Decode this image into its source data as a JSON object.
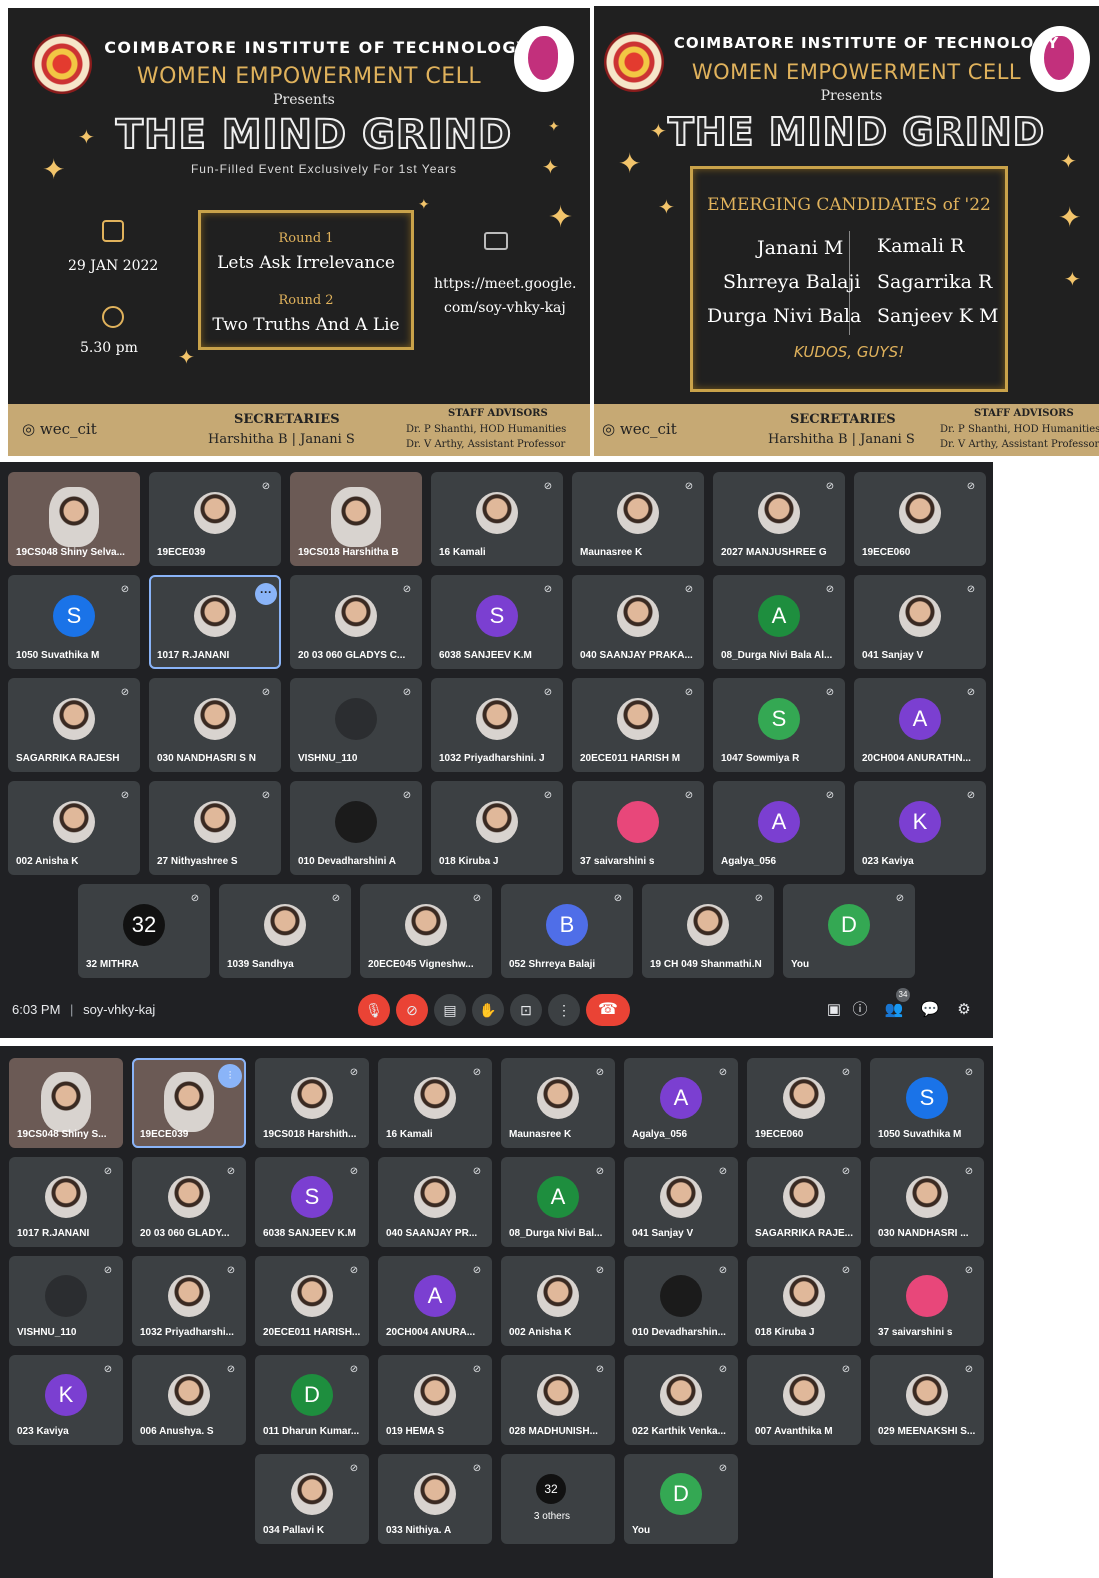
{
  "poster1": {
    "org": "COIMBATORE INSTITUTE OF TECHNOLOGY",
    "cell": "WOMEN EMPOWERMENT CELL",
    "presents": "Presents",
    "title": "THE MIND GRIND",
    "tagline": "Fun-Filled Event Exclusively For 1st Years",
    "date": "29 JAN 2022",
    "time": "5.30 pm",
    "round1_label": "Round 1",
    "round1_name": "Lets Ask Irrelevance",
    "round2_label": "Round 2",
    "round2_name": "Two Truths And A Lie",
    "link_line1": "https://meet.google.",
    "link_line2": "com/soy-vhky-kaj",
    "instagram": "wec_cit",
    "secretaries_heading": "SECRETARIES",
    "secretaries": "Harshitha B | Janani S",
    "advisors_heading": "STAFF ADVISORS",
    "advisor1": "Dr. P Shanthi, HOD Humanities",
    "advisor2": "Dr. V Arthy, Assistant Professor"
  },
  "poster2": {
    "org": "COIMBATORE INSTITUTE OF TECHNOLOGY",
    "cell": "WOMEN EMPOWERMENT CELL",
    "presents": "Presents",
    "title": "THE MIND GRIND",
    "heading": "EMERGING CANDIDATES of '22",
    "winners_left": [
      "Janani M",
      "Shrreya Balaji",
      "Durga Nivi Bala"
    ],
    "winners_right": [
      "Kamali R",
      "Sagarrika R",
      "Sanjeev K M"
    ],
    "kudos": "KUDOS, GUYS!",
    "instagram": "wec_cit",
    "secretaries_heading": "SECRETARIES",
    "secretaries": "Harshitha B | Janani S",
    "advisors_heading": "STAFF ADVISORS",
    "advisor1": "Dr. P Shanthi, HOD Humanities",
    "advisor2": "Dr. V Arthy, Assistant Professor"
  },
  "meet1": {
    "rows": [
      [
        {
          "name": "19CS048 Shiny Selva...",
          "kind": "video"
        },
        {
          "name": "19ECE039",
          "kind": "photo"
        },
        {
          "name": "19CS018 Harshitha B",
          "kind": "video"
        },
        {
          "name": "16 Kamali",
          "kind": "photo"
        },
        {
          "name": "Maunasree K",
          "kind": "photo"
        },
        {
          "name": "2027 MANJUSHREE G",
          "kind": "photo"
        },
        {
          "name": "19ECE060",
          "kind": "photo"
        }
      ],
      [
        {
          "name": "1050 Suvathika M",
          "kind": "letter",
          "letter": "S",
          "color": "#1a73e8"
        },
        {
          "name": "1017 R.JANANI",
          "kind": "photo",
          "active": true
        },
        {
          "name": "20 03 060 GLADYS C...",
          "kind": "photo"
        },
        {
          "name": "6038 SANJEEV K.M",
          "kind": "letter",
          "letter": "S",
          "color": "#7b3fd1"
        },
        {
          "name": "040 SAANJAY PRAKA...",
          "kind": "photo"
        },
        {
          "name": "08_Durga Nivi Bala Al...",
          "kind": "letter",
          "letter": "A",
          "color": "#1e8e3e"
        },
        {
          "name": "041 Sanjay V",
          "kind": "photo"
        }
      ],
      [
        {
          "name": "SAGARRIKA RAJESH",
          "kind": "photo"
        },
        {
          "name": "030 NANDHASRI S N",
          "kind": "photo"
        },
        {
          "name": "VISHNU_110",
          "kind": "grey"
        },
        {
          "name": "1032 Priyadharshini. J",
          "kind": "photo"
        },
        {
          "name": "20ECE011 HARISH M",
          "kind": "photo"
        },
        {
          "name": "1047 Sowmiya R",
          "kind": "letter",
          "letter": "S",
          "color": "#34a853"
        },
        {
          "name": "20CH004 ANURATHN...",
          "kind": "letter",
          "letter": "A",
          "color": "#7b3fd1"
        }
      ],
      [
        {
          "name": "002 Anisha K",
          "kind": "photo"
        },
        {
          "name": "27 Nithyashree S",
          "kind": "photo"
        },
        {
          "name": "010 Devadharshini A",
          "kind": "dark"
        },
        {
          "name": "018 Kiruba J",
          "kind": "photo"
        },
        {
          "name": "37 saivarshini s",
          "kind": "letter",
          "letter": "",
          "color": "#e8477a"
        },
        {
          "name": "Agalya_056",
          "kind": "letter",
          "letter": "A",
          "color": "#7b3fd1"
        },
        {
          "name": "023 Kaviya",
          "kind": "letter",
          "letter": "K",
          "color": "#7b3fd1"
        }
      ],
      [
        {
          "name": "32 MITHRA",
          "kind": "letter",
          "letter": "32",
          "color": "#111111"
        },
        {
          "name": "1039 Sandhya",
          "kind": "photo"
        },
        {
          "name": "20ECE045 Vigneshw...",
          "kind": "photo"
        },
        {
          "name": "052 Shrreya Balaji",
          "kind": "letter",
          "letter": "B",
          "color": "#4f6ee8"
        },
        {
          "name": "19 CH 049 Shanmathi.N",
          "kind": "photo"
        },
        {
          "name": "You",
          "kind": "letter",
          "letter": "D",
          "color": "#34a853"
        }
      ]
    ],
    "time": "6:03 PM",
    "meeting_code": "soy-vhky-kaj",
    "people_count": "34"
  },
  "meet2": {
    "rows": [
      [
        {
          "name": "19CS048 Shiny S...",
          "kind": "video"
        },
        {
          "name": "19ECE039",
          "kind": "video",
          "active": true,
          "speaking": true
        },
        {
          "name": "19CS018 Harshith...",
          "kind": "photo"
        },
        {
          "name": "16 Kamali",
          "kind": "photo"
        },
        {
          "name": "Maunasree K",
          "kind": "photo"
        },
        {
          "name": "Agalya_056",
          "kind": "letter",
          "letter": "A",
          "color": "#7b3fd1"
        },
        {
          "name": "19ECE060",
          "kind": "photo"
        },
        {
          "name": "1050 Suvathika M",
          "kind": "letter",
          "letter": "S",
          "color": "#1a73e8"
        }
      ],
      [
        {
          "name": "1017 R.JANANI",
          "kind": "photo"
        },
        {
          "name": "20 03 060 GLADY...",
          "kind": "photo"
        },
        {
          "name": "6038 SANJEEV K.M",
          "kind": "letter",
          "letter": "S",
          "color": "#7b3fd1"
        },
        {
          "name": "040 SAANJAY PR...",
          "kind": "photo"
        },
        {
          "name": "08_Durga Nivi Bal...",
          "kind": "letter",
          "letter": "A",
          "color": "#1e8e3e"
        },
        {
          "name": "041 Sanjay V",
          "kind": "photo"
        },
        {
          "name": "SAGARRIKA RAJE...",
          "kind": "photo"
        },
        {
          "name": "030 NANDHASRI ...",
          "kind": "photo"
        }
      ],
      [
        {
          "name": "VISHNU_110",
          "kind": "grey"
        },
        {
          "name": "1032 Priyadharshi...",
          "kind": "photo"
        },
        {
          "name": "20ECE011 HARISH...",
          "kind": "photo"
        },
        {
          "name": "20CH004 ANURA...",
          "kind": "letter",
          "letter": "A",
          "color": "#7b3fd1"
        },
        {
          "name": "002 Anisha K",
          "kind": "photo"
        },
        {
          "name": "010 Devadharshin...",
          "kind": "dark"
        },
        {
          "name": "018 Kiruba J",
          "kind": "photo"
        },
        {
          "name": "37 saivarshini s",
          "kind": "letter",
          "letter": "",
          "color": "#e8477a"
        }
      ],
      [
        {
          "name": "023 Kaviya",
          "kind": "letter",
          "letter": "K",
          "color": "#7b3fd1"
        },
        {
          "name": "006 Anushya. S",
          "kind": "photo"
        },
        {
          "name": "011 Dharun Kumar...",
          "kind": "letter",
          "letter": "D",
          "color": "#1e8e3e"
        },
        {
          "name": "019 HEMA S",
          "kind": "photo"
        },
        {
          "name": "028 MADHUNISH...",
          "kind": "photo"
        },
        {
          "name": "022 Karthik Venka...",
          "kind": "photo"
        },
        {
          "name": "007 Avanthika M",
          "kind": "photo"
        },
        {
          "name": "029 MEENAKSHI S...",
          "kind": "photo"
        }
      ],
      [
        {
          "name": "034 Pallavi K",
          "kind": "photo"
        },
        {
          "name": "033 Nithiya. A",
          "kind": "photo"
        },
        {
          "name": "3 others",
          "kind": "others",
          "letter": "32"
        },
        {
          "name": "You",
          "kind": "letter",
          "letter": "D",
          "color": "#34a853"
        }
      ]
    ]
  }
}
